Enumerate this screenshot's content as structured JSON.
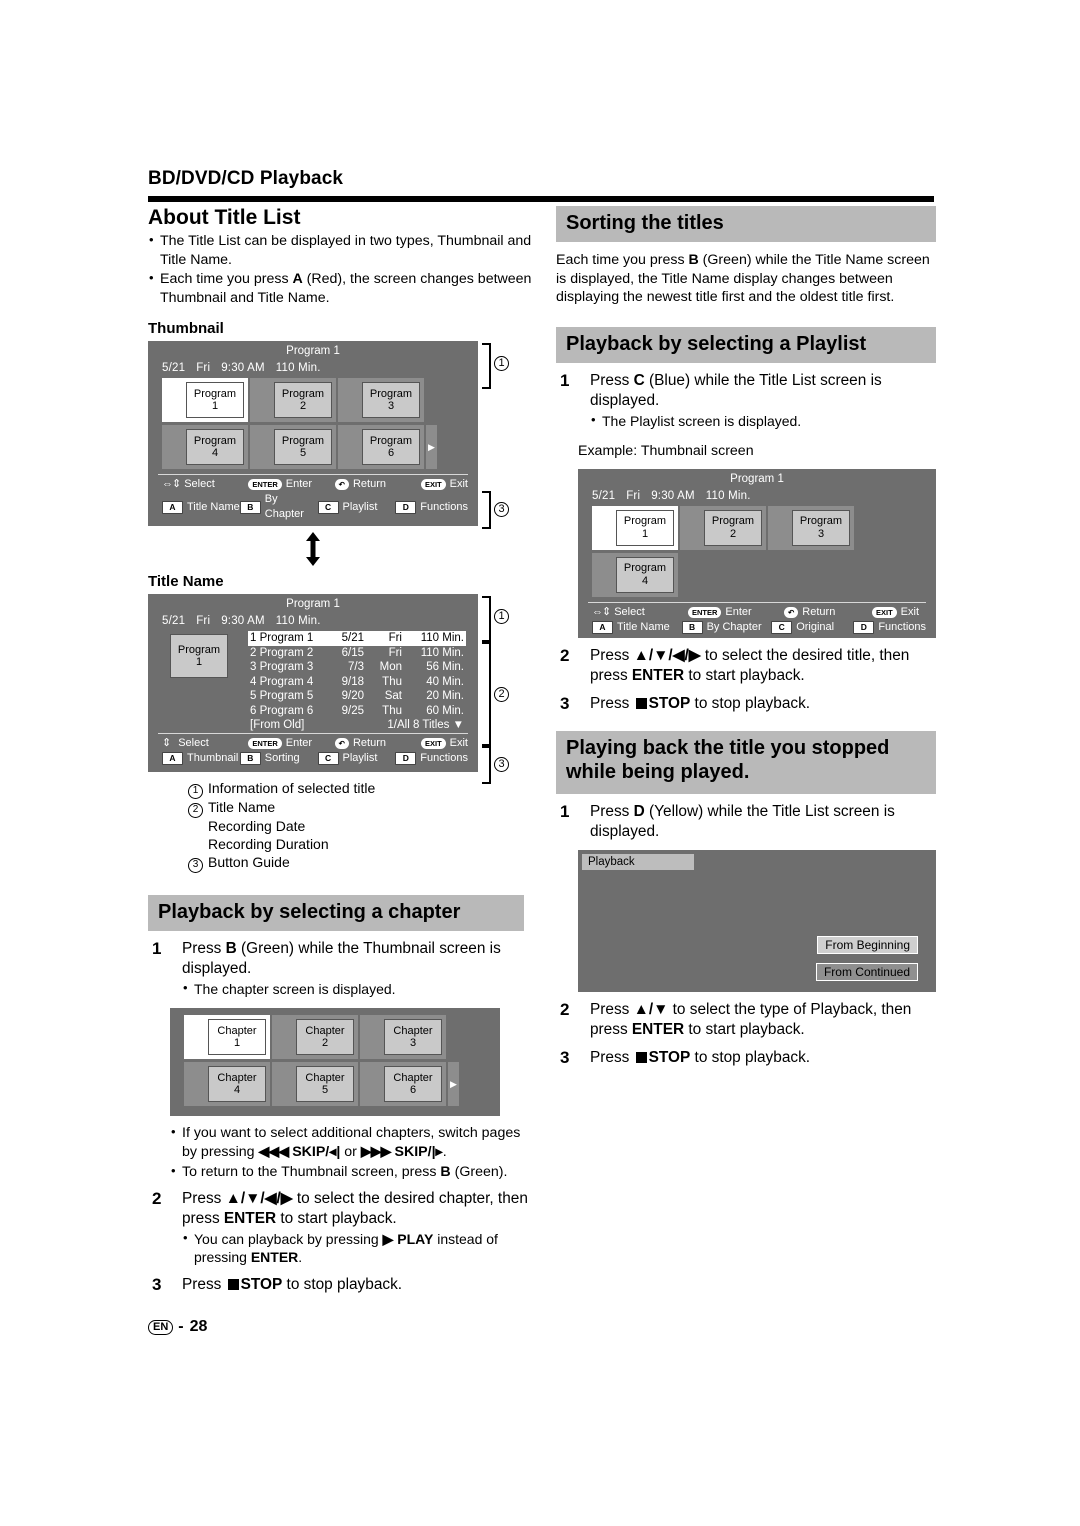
{
  "page": {
    "chapter_title": "BD/DVD/CD Playback",
    "footer_lang": "EN",
    "footer_sep": "-",
    "footer_page": "28"
  },
  "left": {
    "about": {
      "heading": "About Title List",
      "bullets": [
        "The Title List can be displayed in two types, Thumbnail and Title Name.",
        "Each time you press A (Red), the screen changes between Thumbnail and Title Name."
      ]
    },
    "thumbnail_label": "Thumbnail",
    "title_name_label": "Title Name",
    "legend": [
      {
        "num": "1",
        "text": "Information of selected title"
      },
      {
        "num": "2",
        "text": "Title Name"
      },
      {
        "num": "",
        "text": "Recording Date"
      },
      {
        "num": "",
        "text": "Recording Duration"
      },
      {
        "num": "3",
        "text": "Button Guide"
      }
    ],
    "chapter_section": {
      "bar": "Playback by selecting a chapter",
      "step1_num": "1",
      "step1_text": "Press B (Green) while the Thumbnail screen is displayed.",
      "step1_bullets": [
        "The chapter screen is displayed."
      ],
      "after_bullets": [
        "If you want to select additional chapters, switch pages by pressing  |◀◀  SKIP/◀| or ▶▶|  SKIP/|▶.",
        "To return to the Thumbnail screen, press B (Green)."
      ],
      "step2_num": "2",
      "step2_text": "Press ▲/▼/◀/▶ to select the desired chapter, then press ENTER to start playback.",
      "step2_bullets": [
        "You can playback by pressing ▶ PLAY instead of pressing ENTER."
      ],
      "step3_num": "3",
      "step3_text": "Press ■ STOP to stop playback."
    }
  },
  "right": {
    "sorting": {
      "bar": "Sorting the titles",
      "body": "Each time you press B (Green) while the Title Name screen is displayed, the Title Name display changes between displaying the newest title first and the oldest title first."
    },
    "playlist": {
      "bar": "Playback by selecting a Playlist",
      "step1_num": "1",
      "step1_text": "Press C (Blue) while the Title List screen is displayed.",
      "step1_bullets": [
        "The Playlist screen is displayed."
      ],
      "example_label": "Example: Thumbnail screen",
      "step2_num": "2",
      "step2_text": "Press ▲/▼/◀/▶ to select the desired title, then press ENTER to start playback.",
      "step3_num": "3",
      "step3_text": "Press ■ STOP to stop playback."
    },
    "resume": {
      "bar_line1": "Playing back the title you stopped",
      "bar_line2": "while being played.",
      "step1_num": "1",
      "step1_text": "Press D (Yellow) while the Title List screen is displayed.",
      "step2_num": "2",
      "step2_text": "Press ▲/▼ to select the type of Playback, then press ENTER to start playback.",
      "step3_num": "3",
      "step3_text": "Press ■ STOP to stop playback."
    }
  },
  "screens": {
    "thumbnail": {
      "title": "Program 1",
      "info": [
        "5/21",
        "Fri",
        "9:30 AM",
        "110 Min."
      ],
      "cells": [
        {
          "line1": "Program",
          "line2": "1",
          "selected": true
        },
        {
          "line1": "Program",
          "line2": "2",
          "selected": false
        },
        {
          "line1": "Program",
          "line2": "3",
          "selected": false
        },
        {
          "line1": "Program",
          "line2": "4",
          "selected": false
        },
        {
          "line1": "Program",
          "line2": "5",
          "selected": false
        },
        {
          "line1": "Program",
          "line2": "6",
          "selected": false
        }
      ],
      "guide_row1": [
        {
          "icon": "dpad-icon",
          "key": "",
          "label": "Select"
        },
        {
          "icon": "enter-key-icon",
          "key": "ENTER",
          "label": "Enter"
        },
        {
          "icon": "return-key-icon",
          "key": "",
          "label": "Return"
        },
        {
          "icon": "exit-key-icon",
          "key": "",
          "label": "Exit"
        }
      ],
      "guide_row2": [
        {
          "key": "A",
          "label": "Title Name"
        },
        {
          "key": "B",
          "label": "By Chapter"
        },
        {
          "key": "C",
          "label": "Playlist"
        },
        {
          "key": "D",
          "label": "Functions"
        }
      ]
    },
    "title_name": {
      "title": "Program 1",
      "info": [
        "5/21",
        "Fri",
        "9:30 AM",
        "110 Min."
      ],
      "thumb": {
        "line1": "Program",
        "line2": "1"
      },
      "rows": [
        {
          "name": "1 Program 1",
          "date": "5/21",
          "day": "Fri",
          "dur": "110 Min.",
          "selected": true
        },
        {
          "name": "2 Program 2",
          "date": "6/15",
          "day": "Fri",
          "dur": "110 Min.",
          "selected": false
        },
        {
          "name": "3 Program 3",
          "date": "7/3",
          "day": "Mon",
          "dur": "56 Min.",
          "selected": false
        },
        {
          "name": "4 Program 4",
          "date": "9/18",
          "day": "Thu",
          "dur": "40 Min.",
          "selected": false
        },
        {
          "name": "5 Program 5",
          "date": "9/20",
          "day": "Sat",
          "dur": "20 Min.",
          "selected": false
        },
        {
          "name": "6 Program 6",
          "date": "9/25",
          "day": "Thu",
          "dur": "60 Min.",
          "selected": false
        }
      ],
      "sort_label": "[From Old]",
      "count_label": "1/All 8 Titles",
      "guide_row1": [
        {
          "icon": "updown-icon",
          "key": "",
          "label": "Select"
        },
        {
          "icon": "enter-key-icon",
          "key": "ENTER",
          "label": "Enter"
        },
        {
          "icon": "return-key-icon",
          "key": "",
          "label": "Return"
        },
        {
          "icon": "exit-key-icon",
          "key": "",
          "label": "Exit"
        }
      ],
      "guide_row2": [
        {
          "key": "A",
          "label": "Thumbnail"
        },
        {
          "key": "B",
          "label": "Sorting"
        },
        {
          "key": "C",
          "label": "Playlist"
        },
        {
          "key": "D",
          "label": "Functions"
        }
      ]
    },
    "chapter": {
      "cells": [
        {
          "line1": "Chapter",
          "line2": "1",
          "selected": true
        },
        {
          "line1": "Chapter",
          "line2": "2",
          "selected": false
        },
        {
          "line1": "Chapter",
          "line2": "3",
          "selected": false
        },
        {
          "line1": "Chapter",
          "line2": "4",
          "selected": false
        },
        {
          "line1": "Chapter",
          "line2": "5",
          "selected": false
        },
        {
          "line1": "Chapter",
          "line2": "6",
          "selected": false
        }
      ]
    },
    "playlist": {
      "title": "Program 1",
      "info": [
        "5/21",
        "Fri",
        "9:30 AM",
        "110 Min."
      ],
      "cells": [
        {
          "line1": "Program",
          "line2": "1",
          "selected": true
        },
        {
          "line1": "Program",
          "line2": "2",
          "selected": false
        },
        {
          "line1": "Program",
          "line2": "3",
          "selected": false
        },
        {
          "line1": "Program",
          "line2": "4",
          "selected": false
        }
      ],
      "guide_row1": [
        {
          "icon": "dpad-icon",
          "key": "",
          "label": "Select"
        },
        {
          "icon": "enter-key-icon",
          "key": "ENTER",
          "label": "Enter"
        },
        {
          "icon": "return-key-icon",
          "key": "",
          "label": "Return"
        },
        {
          "icon": "exit-key-icon",
          "key": "",
          "label": "Exit"
        }
      ],
      "guide_row2": [
        {
          "key": "A",
          "label": "Title Name"
        },
        {
          "key": "B",
          "label": "By Chapter"
        },
        {
          "key": "C",
          "label": "Original"
        },
        {
          "key": "D",
          "label": "Functions"
        }
      ]
    },
    "playback": {
      "tab": "Playback",
      "buttons": [
        "From Beginning",
        "From Continued"
      ]
    }
  }
}
